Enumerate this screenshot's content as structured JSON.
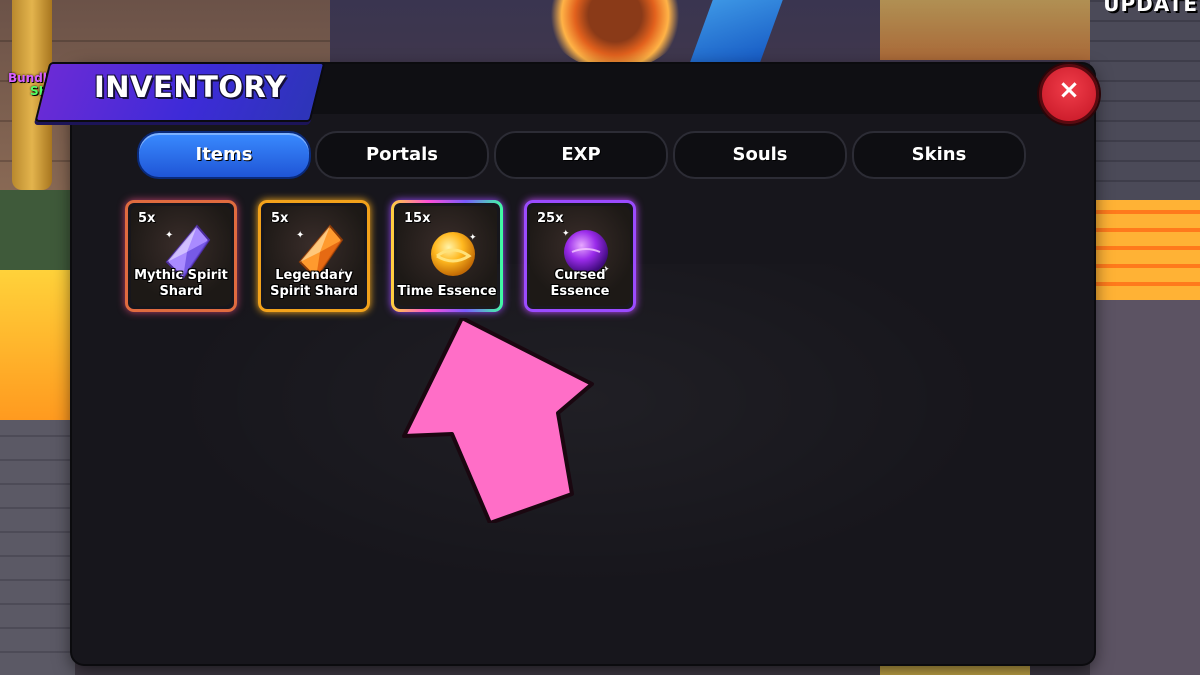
{
  "side_widgets": {
    "shop_line1": "Bundl",
    "shop_line2": "SHO",
    "update_label": "UPDATE"
  },
  "inventory": {
    "title": "INVENTORY",
    "close_symbol": "×",
    "tabs": [
      {
        "label": "Items",
        "active": true
      },
      {
        "label": "Portals",
        "active": false
      },
      {
        "label": "EXP",
        "active": false
      },
      {
        "label": "Souls",
        "active": false
      },
      {
        "label": "Skins",
        "active": false
      }
    ],
    "items": [
      {
        "qty": "5x",
        "name_line1": "Mythic Spirit",
        "name_line2": "Shard",
        "icon": "purple-crystal-icon"
      },
      {
        "qty": "5x",
        "name_line1": "Legendary",
        "name_line2": "Spirit Shard",
        "icon": "orange-crystal-icon"
      },
      {
        "qty": "15x",
        "name_line1": "Time Essence",
        "name_line2": "",
        "icon": "golden-orb-icon"
      },
      {
        "qty": "25x",
        "name_line1": "Cursed",
        "name_line2": "Essence",
        "icon": "purple-orb-icon"
      }
    ]
  },
  "colors": {
    "panel_bg": "#17161c",
    "tab_active": "#2f6ef0",
    "close_button": "#e02a3a",
    "title_box": "#4a2bd8",
    "annotation_arrow": "#ff6ec7"
  },
  "annotation": {
    "icon": "pink-pointer-arrow-icon"
  }
}
